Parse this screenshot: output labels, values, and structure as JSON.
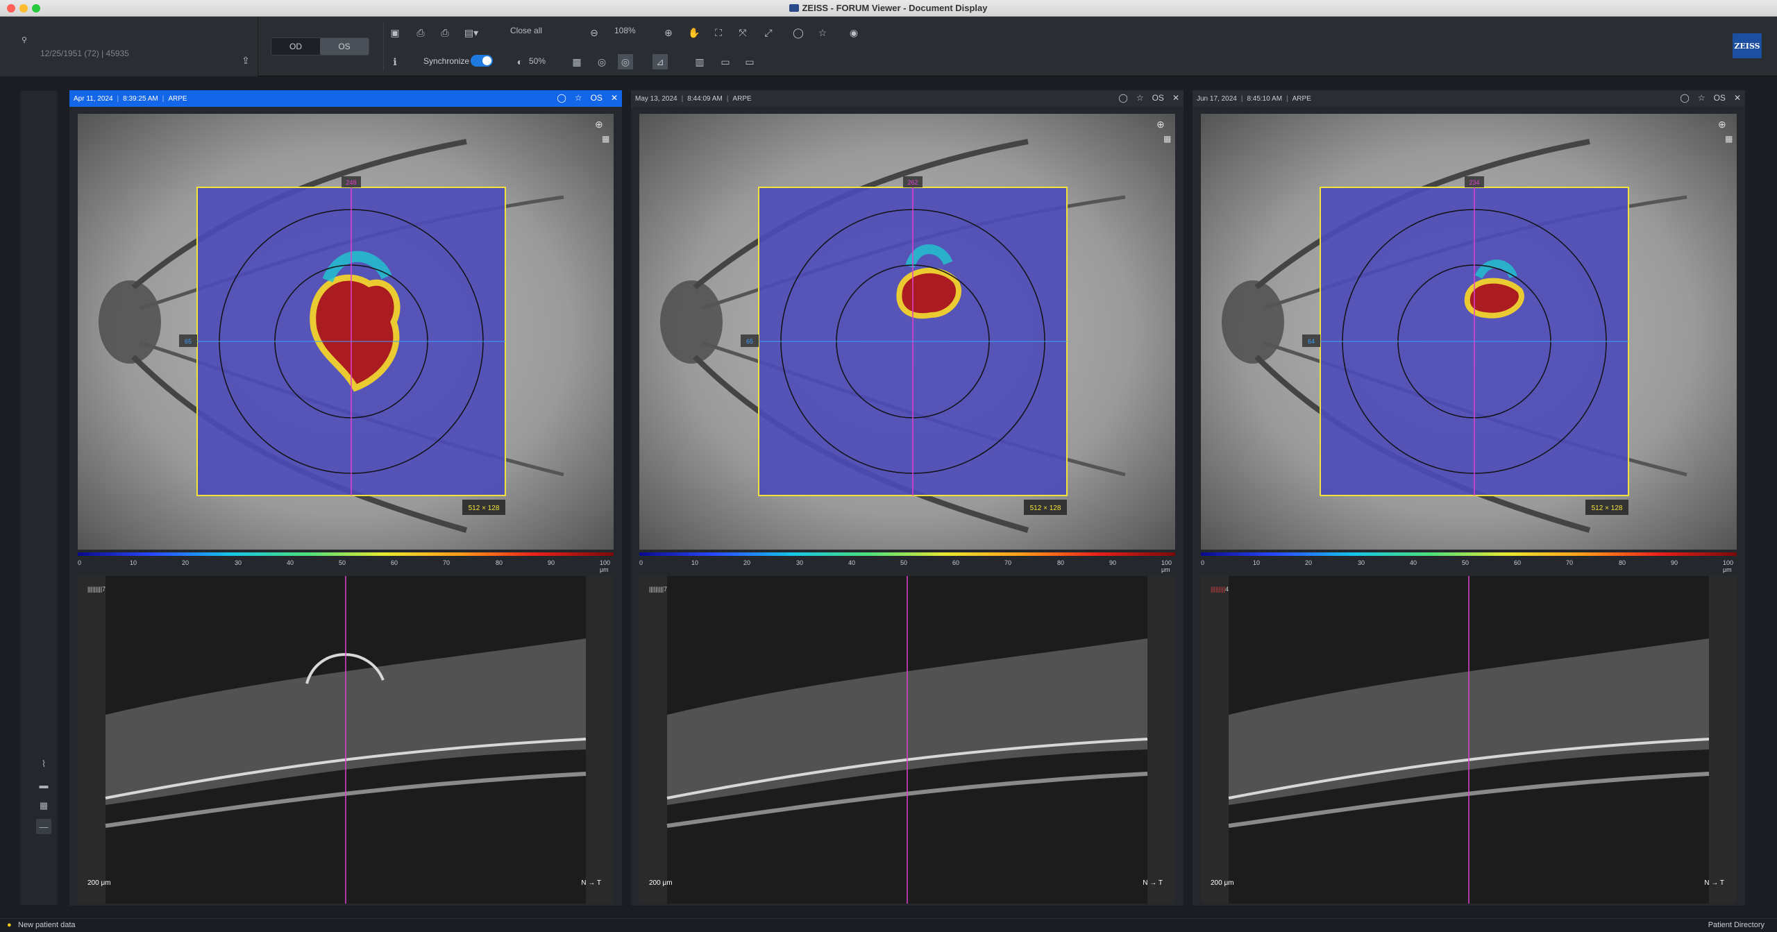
{
  "window": {
    "title": "ZEISS - FORUM Viewer - Document Display"
  },
  "patient": {
    "info": "12/25/1951 (72)  |  45935"
  },
  "toolbar": {
    "eye_od": "OD",
    "eye_os": "OS",
    "close_all": "Close all",
    "zoom": "108%",
    "synchronize": "Synchronize",
    "opacity": "50%",
    "brand": "ZEISS"
  },
  "panels": [
    {
      "date": "Apr 11, 2024",
      "time": "8:39:25 AM",
      "mode": "ARPE",
      "eye": "OS",
      "active": true,
      "top_marker": "248",
      "left_marker": "65",
      "grid": "512 × 128",
      "oct_label": "7",
      "scale": "200 μm",
      "nt": "N → T"
    },
    {
      "date": "May 13, 2024",
      "time": "8:44:09 AM",
      "mode": "ARPE",
      "eye": "OS",
      "active": false,
      "top_marker": "262",
      "left_marker": "65",
      "grid": "512 × 128",
      "oct_label": "7",
      "scale": "200 μm",
      "nt": "N → T"
    },
    {
      "date": "Jun 17, 2024",
      "time": "8:45:10 AM",
      "mode": "ARPE",
      "eye": "OS",
      "active": false,
      "top_marker": "234",
      "left_marker": "64",
      "grid": "512 × 128",
      "oct_label": "4",
      "scale": "200 μm",
      "nt": "N → T"
    }
  ],
  "colorscale": {
    "ticks": [
      "0",
      "10",
      "20",
      "30",
      "40",
      "50",
      "60",
      "70",
      "80",
      "90",
      "100 μm"
    ]
  },
  "status": {
    "left": "New patient data",
    "right": "Patient Directory"
  }
}
